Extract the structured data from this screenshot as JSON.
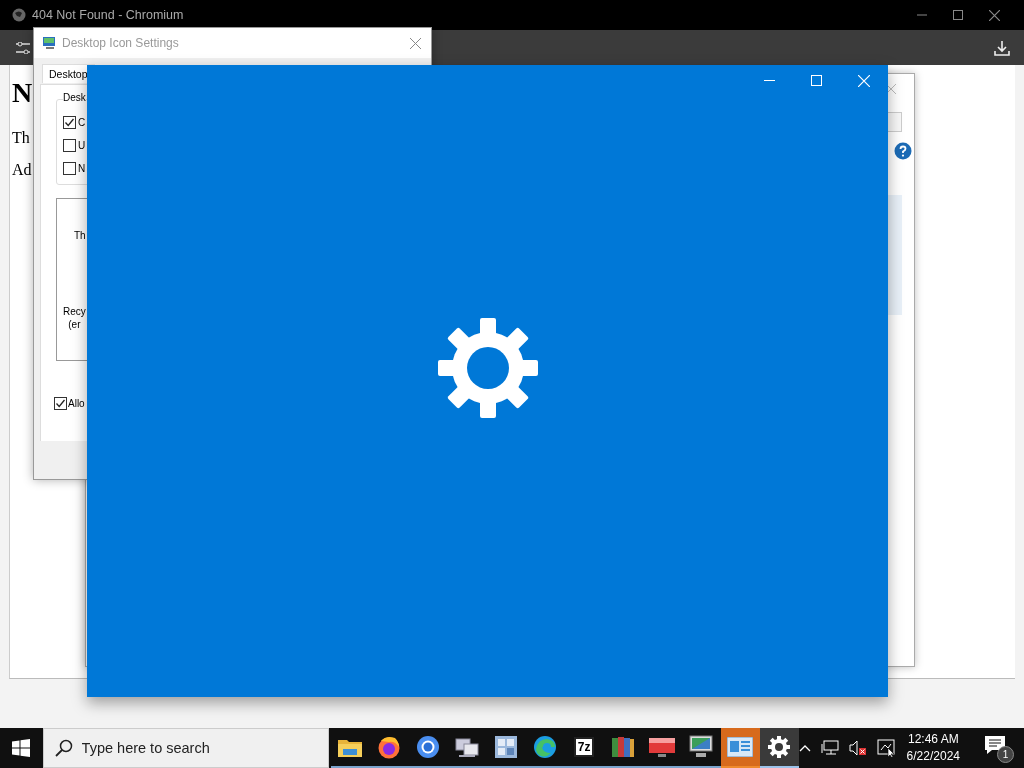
{
  "browser": {
    "title": "404 Not Found - Chromium",
    "page": {
      "heading": "N",
      "lines": [
        "Th",
        "Ad"
      ]
    }
  },
  "icon_dialog": {
    "title": "Desktop Icon Settings",
    "tabs": [
      {
        "label": "Desktop",
        "selected": true
      }
    ],
    "group_label": "Desk",
    "checkboxes": [
      {
        "label": "C",
        "checked": true
      },
      {
        "label": "U",
        "checked": false
      },
      {
        "label": "N",
        "checked": false
      }
    ],
    "icons": [
      {
        "lines": [
          "Th"
        ]
      },
      {
        "lines": [
          "Recy",
          "(er"
        ]
      }
    ],
    "allow": {
      "label": "Allo",
      "checked": true
    }
  },
  "taskbar": {
    "search": {
      "placeholder": "Type here to search"
    },
    "apps": [
      {
        "kind": "folder",
        "selected": false,
        "flashing": false
      },
      {
        "kind": "firefox",
        "selected": false,
        "flashing": false
      },
      {
        "kind": "chromium",
        "selected": false,
        "flashing": false
      },
      {
        "kind": "network",
        "selected": false,
        "flashing": false
      },
      {
        "kind": "tools",
        "selected": false,
        "flashing": false
      },
      {
        "kind": "edge",
        "selected": false,
        "flashing": false
      },
      {
        "kind": "archive",
        "label": "7z",
        "selected": false,
        "flashing": false
      },
      {
        "kind": "books",
        "selected": false,
        "flashing": false
      },
      {
        "kind": "monitor",
        "selected": false,
        "flashing": false
      },
      {
        "kind": "computer",
        "selected": false,
        "flashing": false
      },
      {
        "kind": "panel",
        "selected": false,
        "flashing": true
      },
      {
        "kind": "settings",
        "selected": true,
        "flashing": false
      }
    ],
    "time": "12:46 AM",
    "date": "6/22/2024",
    "notifications": "1"
  }
}
